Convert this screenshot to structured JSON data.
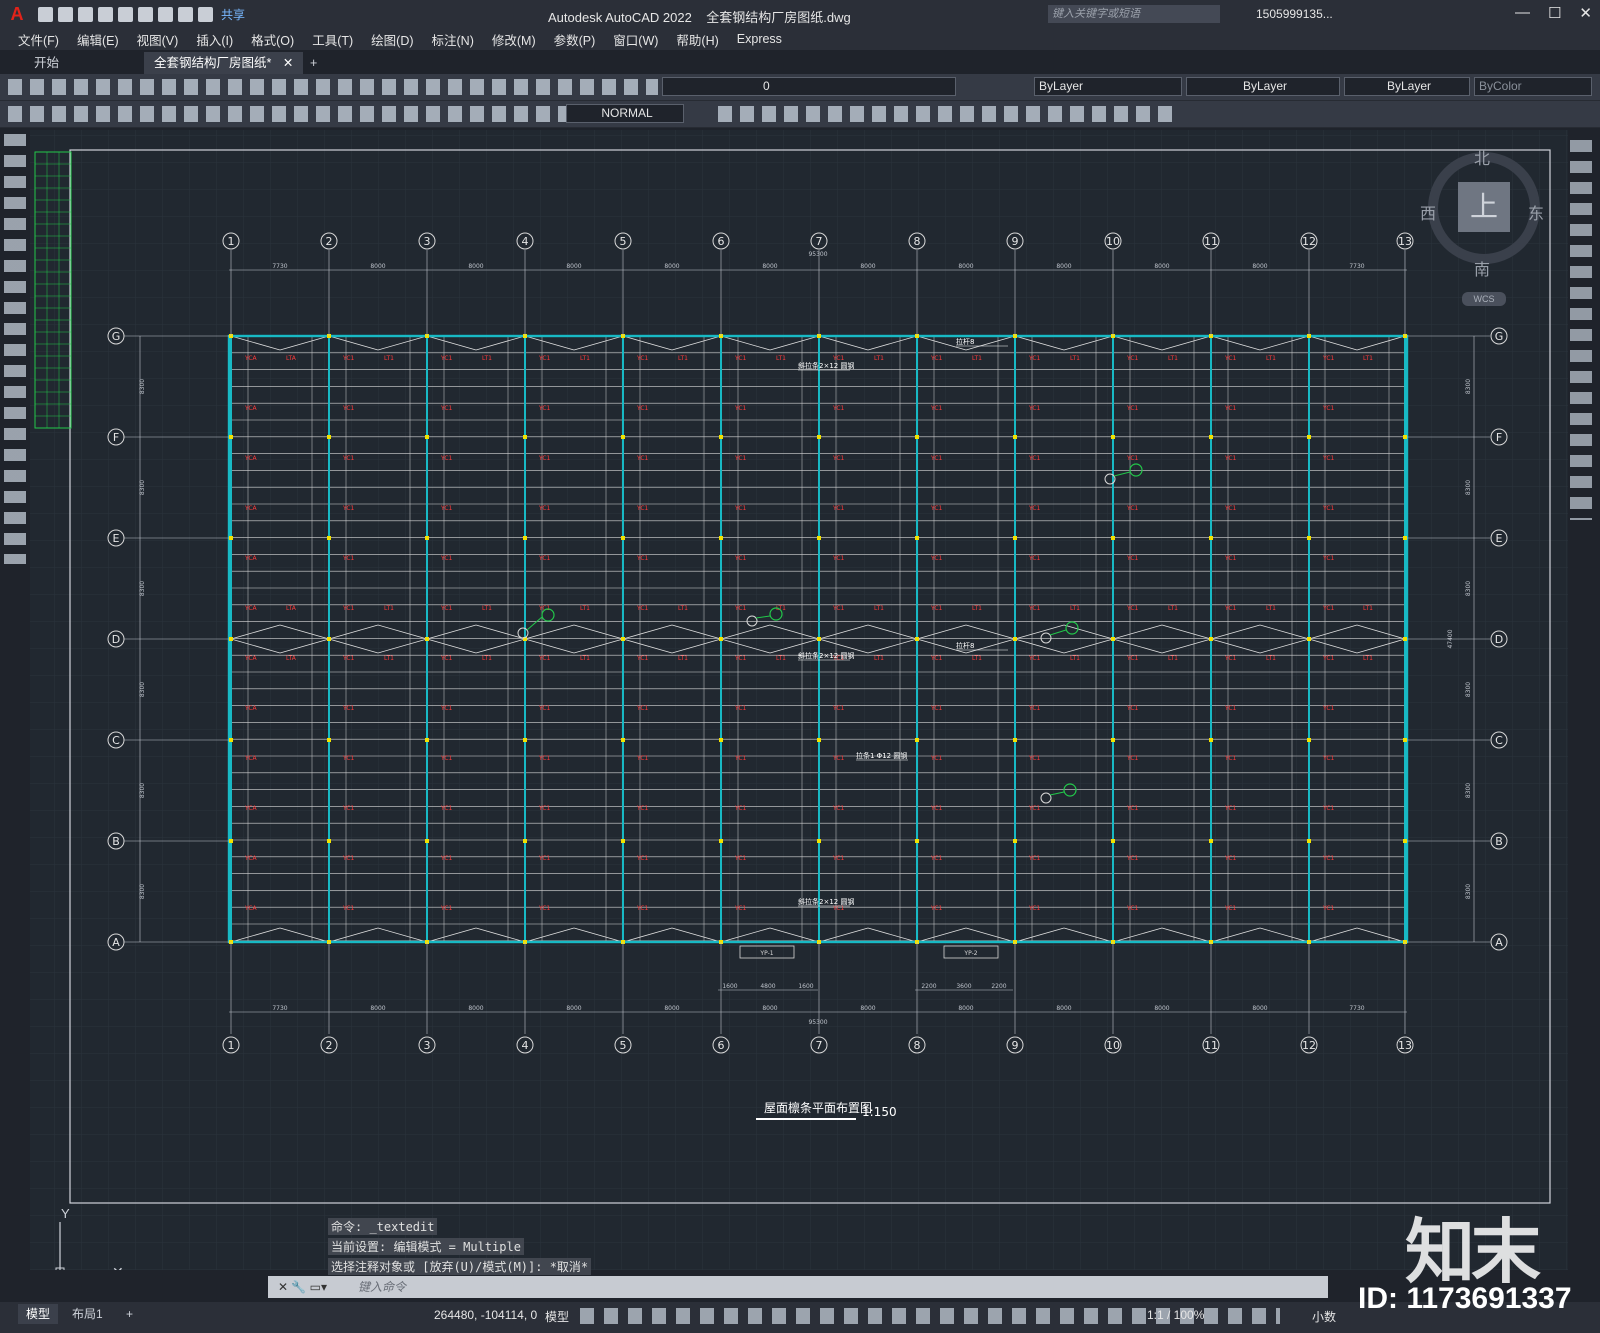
{
  "titlebar": {
    "app_title": "Autodesk AutoCAD 2022    全套钢结构厂房图纸.dwg",
    "share": "共享",
    "search_placeholder": "键入关键字或短语",
    "user": "1505999135..."
  },
  "menu": [
    "文件(F)",
    "编辑(E)",
    "视图(V)",
    "插入(I)",
    "格式(O)",
    "工具(T)",
    "绘图(D)",
    "标注(N)",
    "修改(M)",
    "参数(P)",
    "窗口(W)",
    "帮助(H)",
    "Express"
  ],
  "doc_tabs": {
    "start": "开始",
    "current": "全套钢结构厂房图纸*"
  },
  "toolbar": {
    "layer": "0",
    "color": "ByLayer",
    "linetype": "ByLayer",
    "lineweight": "ByLayer",
    "plotstyle": "ByColor",
    "dimstyle": "NORMAL"
  },
  "viewcube": {
    "north": "北",
    "south": "南",
    "east": "东",
    "west": "西",
    "top": "上",
    "wcs": "WCS"
  },
  "drawing": {
    "column_axes": [
      "1",
      "2",
      "3",
      "4",
      "5",
      "6",
      "7",
      "8",
      "9",
      "10",
      "11",
      "12",
      "13"
    ],
    "row_axes": [
      "G",
      "F",
      "E",
      "D",
      "C",
      "B",
      "A"
    ],
    "top_dims": [
      "7730",
      "8000",
      "8000",
      "8000",
      "8000",
      "8000",
      "8000",
      "8000",
      "8000",
      "8000",
      "8000",
      "7730"
    ],
    "total_length": "95300",
    "total_width": "47400",
    "bay_widths": [
      "8300",
      "8300",
      "8300",
      "8300",
      "8300",
      "8300"
    ],
    "lower_dims_left": [
      "1600",
      "4800",
      "1600"
    ],
    "lower_dims_right": [
      "2200",
      "3600",
      "2200"
    ],
    "door_labels": [
      "YP-1",
      "YP-2"
    ],
    "callouts": [
      "拉杆8",
      "拉杆8",
      "斜拉条2×12 圆钢",
      "斜拉条2×12 圆钢",
      "拉条1 Φ12 圆钢",
      "斜拉条2×12 圆钢"
    ],
    "red_labels": {
      "rafter": "YC1",
      "brace": "LT1",
      "edge": "YCA",
      "corner": "LTA"
    },
    "plan_title": "屋面檩条平面布置图",
    "scale": "1:150"
  },
  "command": {
    "history": [
      "命令: _textedit",
      "当前设置: 编辑模式 = Multiple",
      "选择注释对象或 [放弃(U)/模式(M)]: *取消*"
    ],
    "placeholder": "键入命令"
  },
  "status": {
    "tab_model": "模型",
    "tab_layout": "布局1",
    "coords": "264480, -104114, 0",
    "mode": "模型",
    "scale": "1:1 / 100%",
    "units": "小数"
  },
  "watermark": {
    "logo": "知末",
    "id": "ID: 1173691337"
  }
}
